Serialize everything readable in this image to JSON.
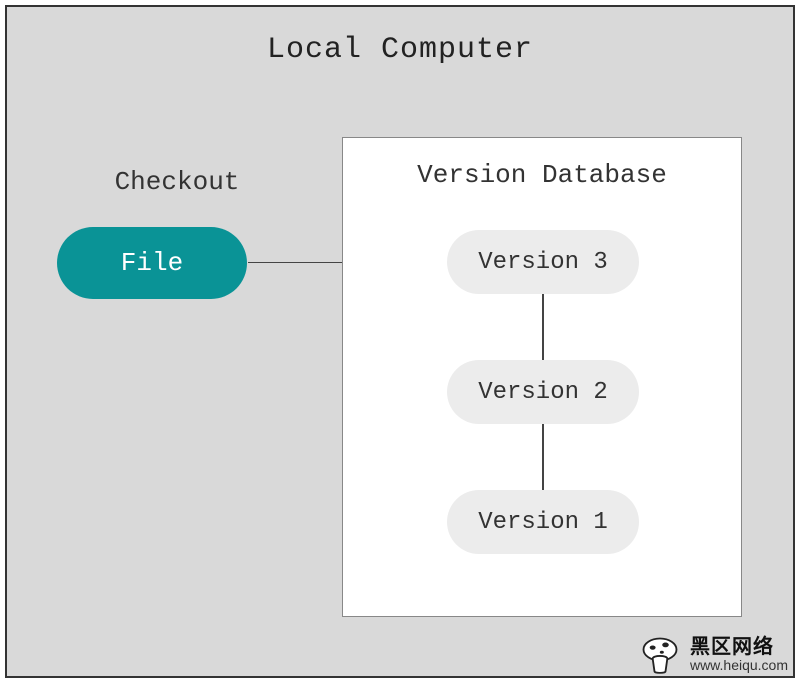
{
  "title": "Local Computer",
  "checkout": {
    "label": "Checkout",
    "file_label": "File"
  },
  "database": {
    "label": "Version Database",
    "versions": {
      "v3": "Version 3",
      "v2": "Version 2",
      "v1": "Version 1"
    }
  },
  "watermark": {
    "line1": "黑区网络",
    "line2": "www.heiqu.com"
  },
  "colors": {
    "outer_bg": "#d9d9d9",
    "accent": "#0a9396",
    "pill_bg": "#ececec"
  }
}
